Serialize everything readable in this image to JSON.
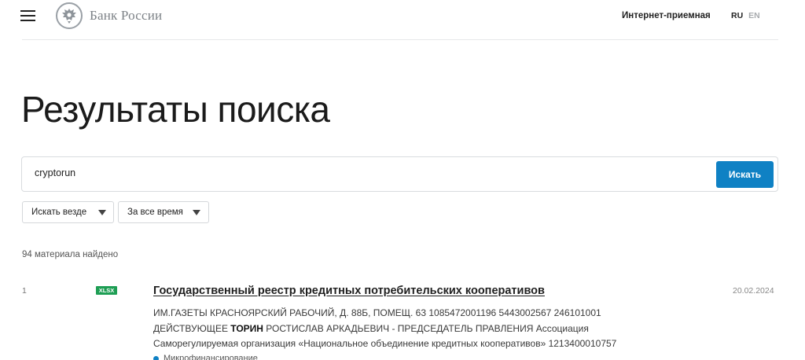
{
  "header": {
    "brand": "Банк России",
    "reception_link": "Интернет-приемная",
    "lang_ru": "RU",
    "lang_en": "EN"
  },
  "page_title": "Результаты поиска",
  "search": {
    "value": "cryptorun",
    "button_label": "Искать"
  },
  "filters": {
    "where_label": "Искать везде",
    "time_label": "За все время"
  },
  "results_count": "94 материала найдено",
  "results": [
    {
      "number": "1",
      "file_type": "XLSX",
      "title": "Государственный реестр кредитных потребительских кооперативов",
      "date": "20.02.2024",
      "snippet_line1": "ИМ.ГАЗЕТЫ КРАСНОЯРСКИЙ РАБОЧИЙ, Д. 88Б, ПОМЕЩ. 63 1085472001196 5443002567 246101001",
      "snippet_line2_pre": "ДЕЙСТВУЮЩЕЕ ",
      "snippet_line2_highlight": "ТОРИН",
      "snippet_line2_post": " РОСТИСЛАВ АРКАДЬЕВИЧ - ПРЕДСЕДАТЕЛЬ ПРАВЛЕНИЯ Ассоциация",
      "snippet_line3": "Саморегулируемая организация «Национальное объединение кредитных кооперативов» 1213400010757",
      "tag": "Микрофинансирование"
    }
  ],
  "colors": {
    "accent": "#0f81c4",
    "xlsx_badge": "#1e9e54"
  }
}
